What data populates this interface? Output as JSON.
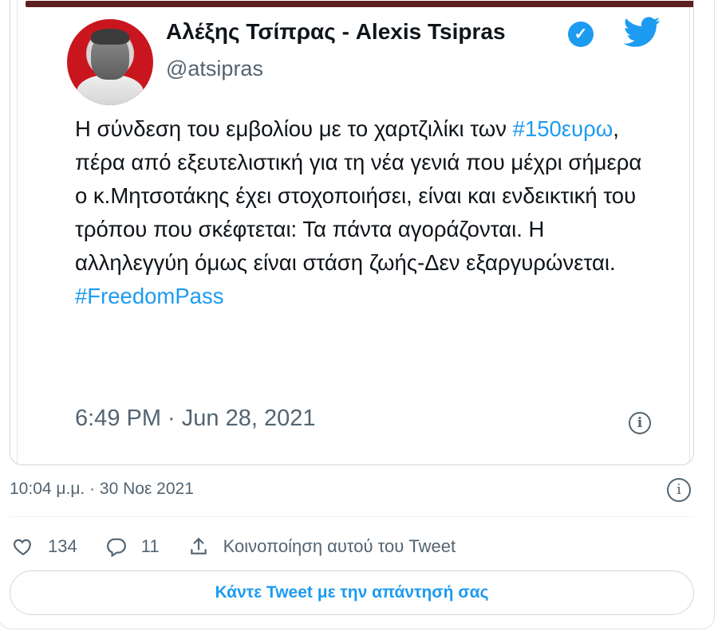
{
  "embedded_tweet": {
    "author_name": "Αλέξης Τσίπρας - Alexis Tsipras",
    "handle": "@atsipras",
    "body_parts": [
      {
        "text": "Η σύνδεση του εμβολίου με το χαρτζιλίκι των ",
        "link": false
      },
      {
        "text": "#150ευρω",
        "link": true
      },
      {
        "text": ", πέρα από εξευτελιστική για τη νέα γενιά που μέχρι σήμερα ο κ.Μητσοτάκης έχει στοχοποιήσει, είναι και ενδεικτική του τρόπου που σκέφτεται: Τα πάντα αγοράζονται. Η αλληλεγγύη όμως είναι στάση ζωής-Δεν εξαργυρώνεται.",
        "link": false
      },
      {
        "text": "#FreedomPass",
        "link": true
      }
    ],
    "timestamp": "6:49 PM · Jun 28, 2021",
    "verified_icon": "verified-badge-icon",
    "brand_icon": "twitter-bird-icon",
    "info_icon": "info-icon",
    "colors": {
      "link": "#1d9bf0",
      "avatar_bg": "#c9161e",
      "verified": "#1d9bf0"
    }
  },
  "tweet_meta": {
    "timestamp": "10:04 μ.μ. · 30 Νοε 2021",
    "info_icon": "info-icon"
  },
  "actions": {
    "likes": "134",
    "replies": "11",
    "share_label": "Κοινοποίηση αυτού του Tweet",
    "icons": [
      "heart-icon",
      "reply-icon",
      "share-icon"
    ]
  },
  "reply": {
    "button_label": "Κάντε Tweet με την απάντησή σας"
  }
}
